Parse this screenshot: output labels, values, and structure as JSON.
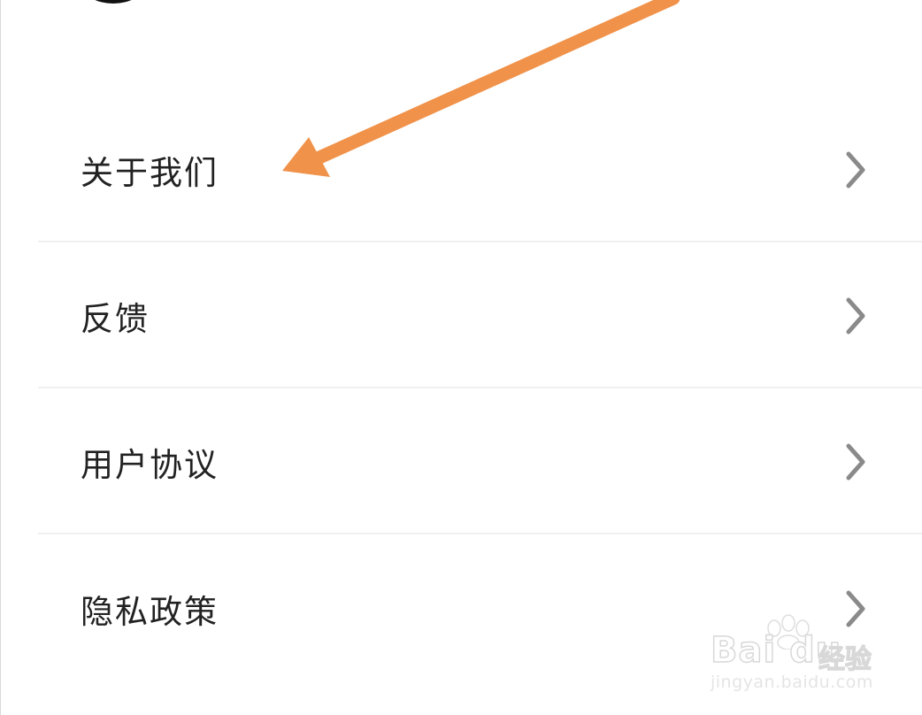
{
  "menu": {
    "items": [
      {
        "label": "关于我们",
        "icon": "chevron-right-icon"
      },
      {
        "label": "反馈",
        "icon": "chevron-right-icon"
      },
      {
        "label": "用户协议",
        "icon": "chevron-right-icon"
      },
      {
        "label": "隐私政策",
        "icon": "chevron-right-icon"
      }
    ]
  },
  "annotation": {
    "arrow_color": "#F0924A",
    "icon": "arrow-annotation"
  },
  "watermark": {
    "logo": "Bai du",
    "brand": "经验",
    "url": "jingyan.baidu.com"
  },
  "colors": {
    "text": "#222222",
    "chevron": "#8a8a8a",
    "divider": "#f0f0f0"
  }
}
